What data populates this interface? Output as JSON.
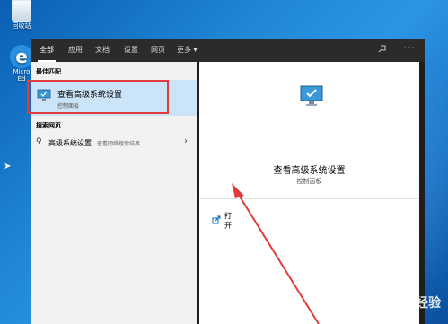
{
  "desktop": {
    "recycle_bin_label": "回收站",
    "edge_label_line1": "Micro",
    "edge_label_line2": "Ed"
  },
  "search": {
    "tabs": [
      {
        "label": "全部",
        "active": true
      },
      {
        "label": "应用"
      },
      {
        "label": "文档"
      },
      {
        "label": "设置"
      },
      {
        "label": "网页"
      },
      {
        "label": "更多 ▾"
      }
    ],
    "best_match_heading": "最佳匹配",
    "best_match": {
      "title": "查看高级系统设置",
      "subtitle": "控制面板",
      "icon": "monitor-check-icon"
    },
    "web_heading": "搜索网页",
    "web_result": {
      "text": "高级系统设置",
      "hint": " - 查看网络搜索结果",
      "icon": "search-icon"
    },
    "preview": {
      "title": "查看高级系统设置",
      "subtitle": "控制面板",
      "open_label": "打开",
      "icon": "monitor-check-icon"
    }
  },
  "watermark": "Baidu 经验",
  "colors": {
    "highlight": "#cce4f7",
    "annotation_red": "#e23b3b"
  }
}
